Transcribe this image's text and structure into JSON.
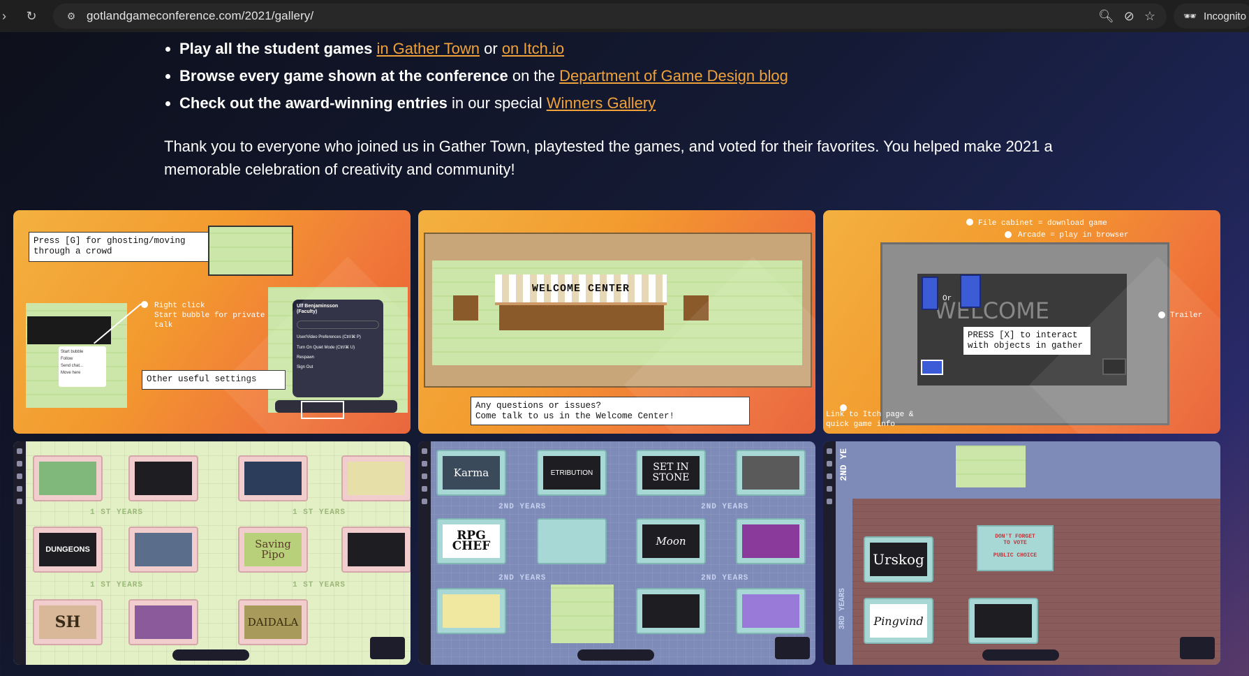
{
  "browser": {
    "url": "gotlandgameconference.com/2021/gallery/",
    "profile_label": "Incognito"
  },
  "links": [
    {
      "bold": "Play all the student games",
      "a1": "in Gather Town",
      "mid": " or ",
      "a2": "on Itch.io"
    },
    {
      "bold": "Browse every game shown at the conference",
      "mid": " on the ",
      "a1": "Department of Game Design blog"
    },
    {
      "bold": "Check out the award-winning entries",
      "mid": " in our special ",
      "a1": "Winners Gallery"
    }
  ],
  "thanks": "Thank you to everyone who joined us in Gather Town, playtested the games, and voted for their favorites. You helped make 2021 a memorable celebration of creativity and community!",
  "gallery": {
    "tile1": {
      "note1": "Press [G] for ghosting/moving\nthrough a crowd",
      "label_rightclick": "Right click\nStart bubble for private\ntalk",
      "note2": "Other useful settings",
      "menu_user": "Ulf Benjaminsson\n(Faculty)",
      "menu_items": [
        "User/Video Preferences (Ctrl/⌘ P)",
        "Turn On Quiet Mode (Ctrl/⌘ U)",
        "Respawn",
        "Sign Out"
      ],
      "popup_items": [
        "Start bubble",
        "Follow",
        "Send chat...",
        "Move here"
      ]
    },
    "tile2": {
      "sign": "WELCOME CENTER",
      "note": "Any questions or issues?\nCome talk to us in the Welcome Center!"
    },
    "tile3": {
      "label_cabinet": "File cabinet = download game",
      "label_arcade": "Arcade = play in browser",
      "label_trailer": "Trailer",
      "label_or": "Or",
      "screen_text": "WELCOME",
      "note": "PRESS [X] to interact\nwith objects in gather",
      "label_link": "Link to Itch page &\nquick game info"
    },
    "tile4": {
      "row_labels": [
        "1 ST YEARS",
        "1 ST YEARS",
        "1 ST YEARS",
        "1 ST YEARS"
      ],
      "booths": [
        "",
        "",
        "",
        "",
        "DUNGEONS",
        "",
        "Saving Pipo",
        "",
        "SH",
        "",
        "DAIDALA"
      ]
    },
    "tile5": {
      "row_labels": [
        "2ND YEARS",
        "2ND YEARS",
        "2ND YEARS",
        "2ND YEARS"
      ],
      "booths": [
        "Karma",
        "ETRIBUTION",
        "SET IN STONE",
        "",
        "RPG CHEF",
        "",
        "Moon",
        "",
        "",
        "",
        ""
      ]
    },
    "tile6": {
      "side_label_top": "2ND YE",
      "side_label_bottom": "3RD YEARS",
      "vote_sign": "DON'T FORGET\nTO VOTE\n\nPUBLIC CHOICE",
      "booths": [
        "Urskog",
        "Pingvind"
      ]
    }
  }
}
